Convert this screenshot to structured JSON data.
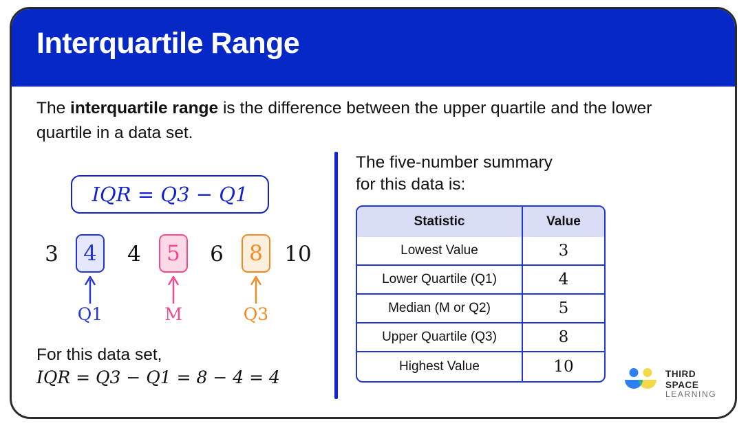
{
  "header": {
    "title": "Interquartile Range",
    "background_color": "#0528c6",
    "title_color": "#ffffff"
  },
  "intro": {
    "before_bold": "The ",
    "bold": "interquartile range",
    "after_bold": " is the difference between the upper quartile and the lower quartile in a data set."
  },
  "formula_box": {
    "formula": "IQR = Q3 − Q1",
    "parts": {
      "lhs": "IQR",
      "equals": "=",
      "term1": "Q3",
      "minus": "−",
      "term2": "Q1"
    },
    "color": "#1122cc"
  },
  "sequence": {
    "items": [
      {
        "value": "3",
        "boxed": false,
        "role": "plain"
      },
      {
        "value": "4",
        "boxed": true,
        "role": "q1",
        "marker": "Q1",
        "color": "#2233d8",
        "fill": "#e4e8fa"
      },
      {
        "value": "4",
        "boxed": false,
        "role": "plain"
      },
      {
        "value": "5",
        "boxed": true,
        "role": "m",
        "marker": "M",
        "color": "#f7488f",
        "fill": "#fcd9e6"
      },
      {
        "value": "6",
        "boxed": false,
        "role": "plain"
      },
      {
        "value": "8",
        "boxed": true,
        "role": "q3",
        "marker": "Q3",
        "color": "#f5881f",
        "fill": "#fdeedd"
      },
      {
        "value": "10",
        "boxed": false,
        "role": "plain"
      }
    ],
    "markers": [
      {
        "label": "Q1",
        "color": "#2233d8"
      },
      {
        "label": "M",
        "color": "#f7488f"
      },
      {
        "label": "Q3",
        "color": "#f5881f"
      }
    ]
  },
  "footnote": {
    "line1": "For this data set,",
    "line2": "IQR = Q3 − Q1 = 8 − 4 = 4"
  },
  "divider": {
    "color": "#1122dd"
  },
  "right": {
    "summary_text_line1": "The five-number summary",
    "summary_text_line2": "for this data is:",
    "table": {
      "columns": [
        "Statistic",
        "Value"
      ],
      "header_background": "#d8dcf5",
      "border_color": "#1f35d6",
      "rows": [
        {
          "statistic": "Lowest Value",
          "value": "3"
        },
        {
          "statistic": "Lower Quartile (Q1)",
          "value": "4"
        },
        {
          "statistic": "Median (M or Q2)",
          "value": "5"
        },
        {
          "statistic": "Upper Quartile (Q3)",
          "value": "8"
        },
        {
          "statistic": "Highest Value",
          "value": "10"
        }
      ]
    }
  },
  "logo": {
    "line1": "THIRD SPACE",
    "line2": "LEARNING",
    "blue": "#2d7ff2",
    "yellow": "#f2d84b",
    "teal": "#2bb88a"
  }
}
